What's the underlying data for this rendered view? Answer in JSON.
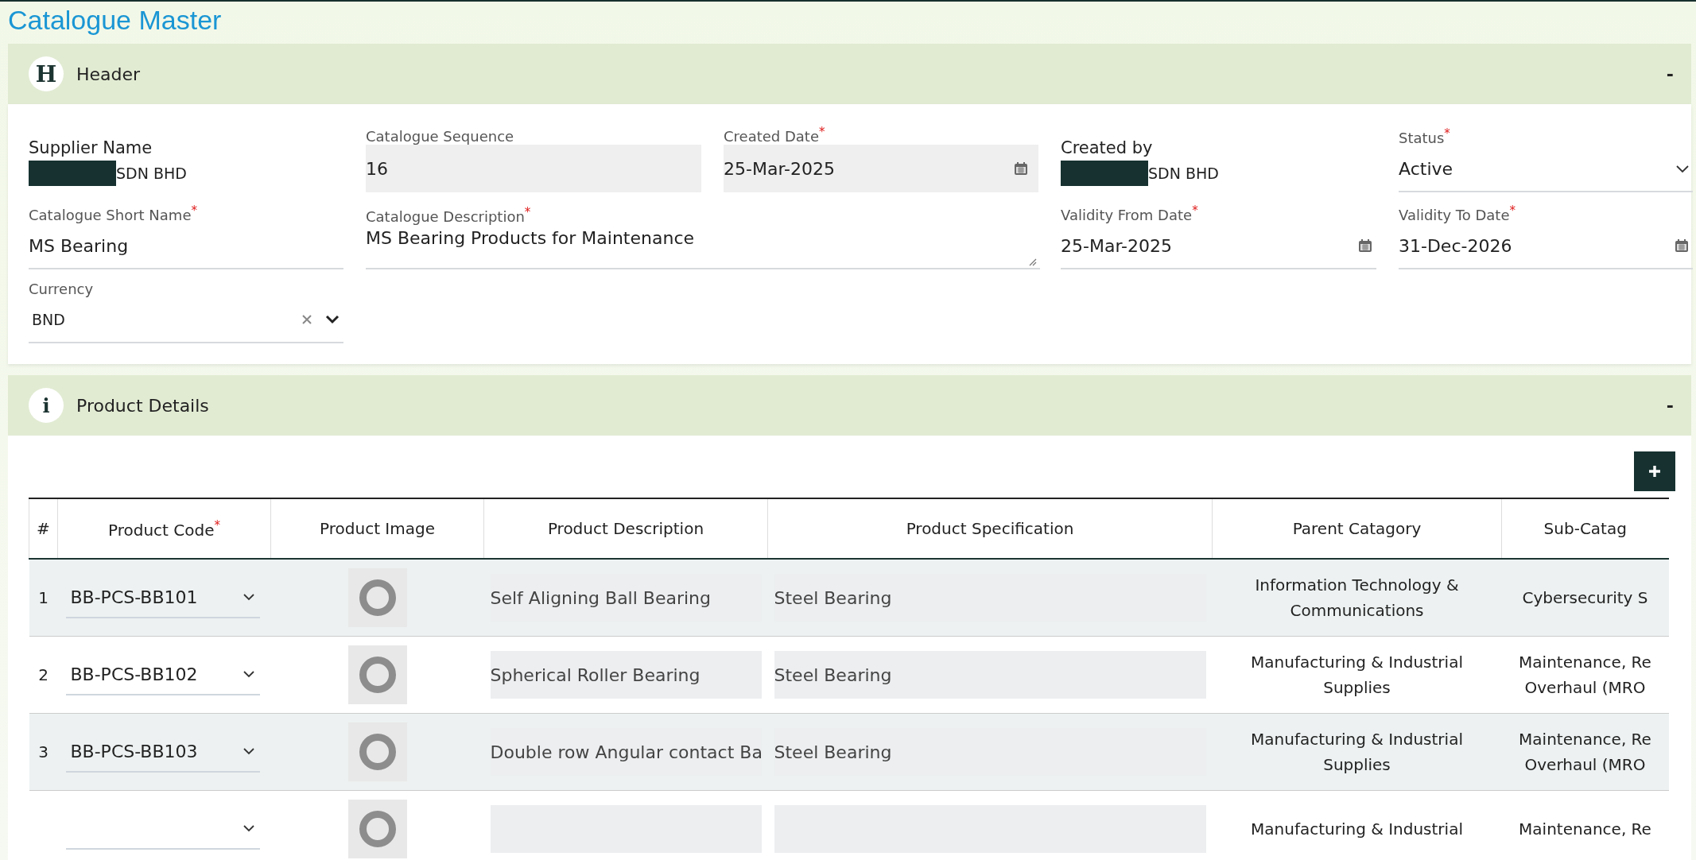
{
  "page_title": "Catalogue Master",
  "header_section": {
    "icon_letter": "H",
    "title": "Header",
    "collapse": "-",
    "fields": [
      {
        "kind": "static",
        "label": "Supplier Name",
        "value": "SDN BHD",
        "redacted": true
      },
      {
        "kind": "input",
        "label": "Catalogue Sequence",
        "value": "16",
        "disabled": true
      },
      {
        "kind": "date",
        "label": "Created Date",
        "required_mark": "*",
        "value": "25-Mar-2025",
        "disabled": true
      },
      {
        "kind": "static",
        "label": "Created by",
        "value": "SDN BHD",
        "redacted": true
      },
      {
        "kind": "select",
        "label": "Status",
        "required_mark": "*",
        "value": "Active"
      },
      {
        "kind": "input",
        "label": "Catalogue Short Name",
        "required_mark": "*",
        "value": "MS Bearing",
        "disabled": false
      },
      {
        "kind": "textarea",
        "label": "Catalogue Description",
        "required_mark": "*",
        "value": "MS Bearing Products for Maintenance"
      },
      {
        "kind": "date",
        "label": "Validity From Date",
        "required_mark": "*",
        "value": "25-Mar-2025",
        "disabled": false
      },
      {
        "kind": "date",
        "label": "Validity To Date",
        "required_mark": "*",
        "value": "31-Dec-2026",
        "disabled": false
      },
      {
        "kind": "combo",
        "label": "Currency",
        "value": "BND"
      }
    ]
  },
  "product_section": {
    "icon_letter": "i",
    "title": "Product Details",
    "collapse": "-",
    "table": {
      "columns": [
        {
          "label": "#"
        },
        {
          "label": "Product Code",
          "required_mark": "*"
        },
        {
          "label": "Product Image"
        },
        {
          "label": "Product Description"
        },
        {
          "label": "Product Specification"
        },
        {
          "label": "Parent Catagory"
        },
        {
          "label": "Sub-Catag"
        }
      ],
      "rows": [
        {
          "number": "1",
          "code": "BB-PCS-BB101",
          "description": "Self Aligning Ball Bearing",
          "specification": "Steel Bearing",
          "parent": "Information Technology & Communications",
          "sub": "Cybersecurity S"
        },
        {
          "number": "2",
          "code": "BB-PCS-BB102",
          "description": "Spherical Roller Bearing",
          "specification": "Steel Bearing",
          "parent": "Manufacturing & Industrial Supplies",
          "sub": "Maintenance, Re\nOverhaul (MRO"
        },
        {
          "number": "3",
          "code": "BB-PCS-BB103",
          "description": "Double row Angular contact Ba",
          "specification": "Steel Bearing",
          "parent": "Manufacturing & Industrial Supplies",
          "sub": "Maintenance, Re\nOverhaul (MRO"
        },
        {
          "parent": "Manufacturing & Industrial",
          "sub": "Maintenance, Re"
        }
      ]
    }
  }
}
